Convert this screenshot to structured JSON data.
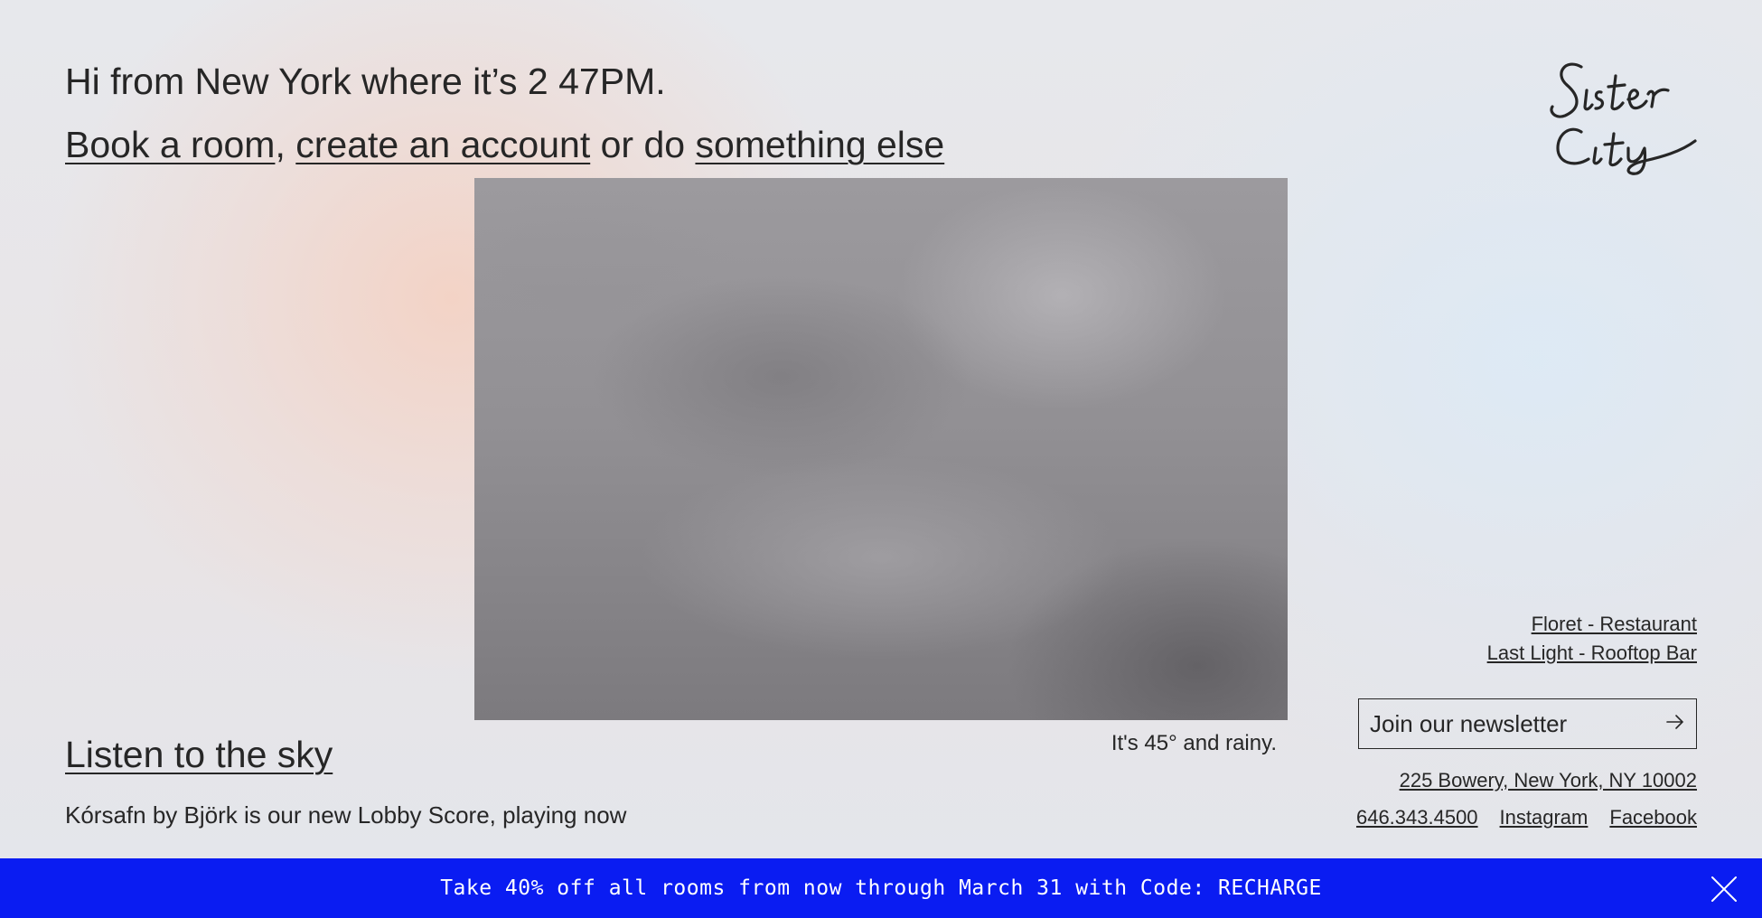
{
  "header": {
    "greeting": "Hi from New York where it’s 2 47PM.",
    "book_link": "Book a room",
    "separator": ",",
    "account_link": "create an account",
    "or_text": " or do ",
    "else_link": "something else"
  },
  "logo": {
    "text": "Sister City",
    "icon": "sister-city-logo"
  },
  "sky": {
    "caption": "It's 45° and rainy."
  },
  "listen": {
    "link": "Listen to the sky",
    "description": "Kórsafn by Björk is our new Lobby Score, playing now"
  },
  "venues": [
    "Floret - Restaurant",
    "Last Light - Rooftop Bar"
  ],
  "newsletter": {
    "label": "Join our newsletter",
    "icon": "arrow-right-icon"
  },
  "contact": {
    "address": "225 Bowery, New York, NY 10002",
    "phone": "646.343.4500",
    "instagram": "Instagram",
    "facebook": "Facebook"
  },
  "promo": {
    "text": "Take 40% off all rooms from now through March 31 with Code: RECHARGE",
    "close_icon": "close-icon"
  },
  "colors": {
    "promo_bg": "#0a1cf2",
    "text": "#262626"
  }
}
